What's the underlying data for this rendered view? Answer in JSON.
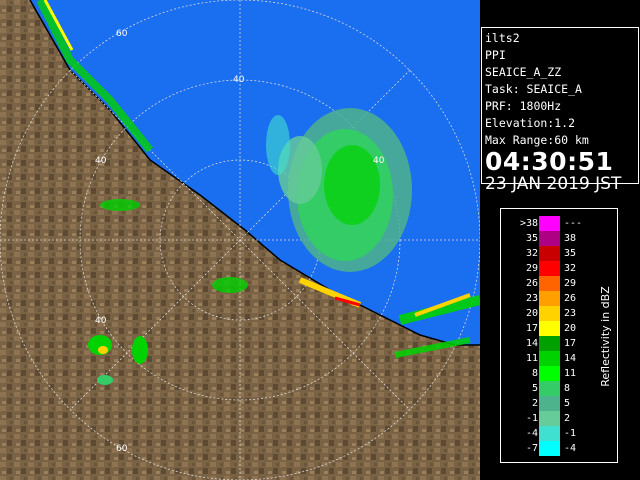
{
  "info": {
    "station": "ilts2",
    "scan_type": "PPI",
    "product": "SEAICE_A_ZZ",
    "task": "Task: SEAICE_A",
    "prf": "PRF: 1800Hz",
    "elevation": "Elevation:1.2",
    "max_range": "Max Range:60 km",
    "time": "04:30:51",
    "date": "23 JAN 2019 JST"
  },
  "legend": {
    "unit_label": "Reflectivity in dBZ",
    "bins": [
      {
        "lo": ">38",
        "hi": "---",
        "color": "#ff00ff"
      },
      {
        "lo": "35",
        "hi": "38",
        "color": "#ad0082"
      },
      {
        "lo": "32",
        "hi": "35",
        "color": "#c80000"
      },
      {
        "lo": "29",
        "hi": "32",
        "color": "#ff0000"
      },
      {
        "lo": "26",
        "hi": "29",
        "color": "#ff6400"
      },
      {
        "lo": "23",
        "hi": "26",
        "color": "#ffa000"
      },
      {
        "lo": "20",
        "hi": "23",
        "color": "#ffd200"
      },
      {
        "lo": "17",
        "hi": "20",
        "color": "#ffff00"
      },
      {
        "lo": "14",
        "hi": "17",
        "color": "#00a000"
      },
      {
        "lo": "11",
        "hi": "14",
        "color": "#00d200"
      },
      {
        "lo": "8",
        "hi": "11",
        "color": "#00ff00"
      },
      {
        "lo": "5",
        "hi": "8",
        "color": "#33cc66"
      },
      {
        "lo": "2",
        "hi": "5",
        "color": "#4db38c"
      },
      {
        "lo": "-1",
        "hi": "2",
        "color": "#66cc99"
      },
      {
        "lo": "-4",
        "hi": "-1",
        "color": "#40e0d0"
      },
      {
        "lo": "-7",
        "hi": "-4",
        "color": "#00ffff"
      }
    ]
  },
  "map": {
    "range_ring_labels": [
      "60",
      "40",
      "40",
      "40",
      "40",
      "60"
    ],
    "colors": {
      "sea": "#1a6ef0",
      "land": "#7a6244",
      "ring": "#d8d8d8",
      "coast": "#000000"
    }
  }
}
